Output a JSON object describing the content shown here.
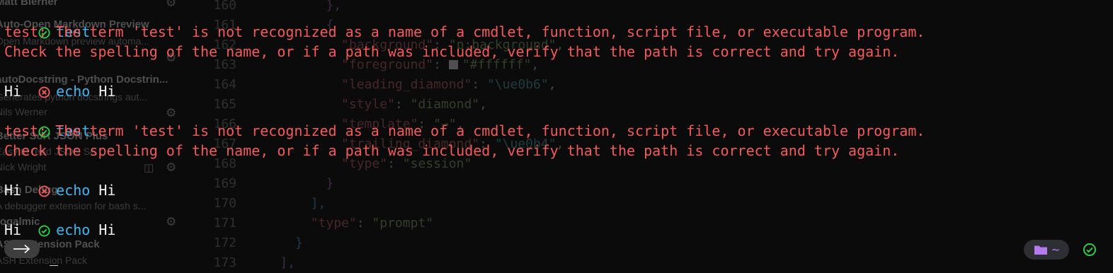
{
  "background_extensions": [
    {
      "title": "Matt Bierner",
      "desc": ""
    },
    {
      "title": "Auto-Open Markdown Preview",
      "desc": "Open Markdown preview automa..."
    },
    {
      "title": "autoDocstring - Python Docstrin...",
      "desc": "Generates python docstrings aut..."
    },
    {
      "title": "Nils Werner",
      "desc": ""
    },
    {
      "title": "Better Sort JSON Plus",
      "desc": "Easy to read JSON Se..."
    },
    {
      "title": "Nick Wright",
      "desc": ""
    },
    {
      "title": "Bash Debug",
      "desc": "A debugger extension for bash s..."
    },
    {
      "title": "rogalmic",
      "desc": ""
    },
    {
      "title": "ASH Extension Pack",
      "desc": "ASH Extension Pack"
    }
  ],
  "background_code": {
    "line_numbers": [
      "160",
      "161",
      "162",
      "163",
      "164",
      "165",
      "166",
      "167",
      "168",
      "169",
      "170",
      "171",
      "172",
      "173"
    ],
    "background_key": "\"background\"",
    "background_val": "\"p:background\"",
    "foreground_key": "\"foreground\"",
    "foreground_val": "\"#ffffff\"",
    "leading_key": "\"leading_diamond\"",
    "leading_val": "\"\\ue0b6\"",
    "style_key": "\"style\"",
    "style_val": "\"diamond\"",
    "template_key": "\"template\"",
    "template_val": "\"→\"",
    "trailing_key": "\"trailing_diamond\"",
    "trailing_val": "\"\\ue0b4\"",
    "type_key": "\"type\"",
    "type_val": "\"session\"",
    "type2_val": "\"prompt\""
  },
  "terminal": {
    "cmd_test": "test",
    "cmd_echo": "echo",
    "arg_hi": "Hi",
    "output_hi": "Hi",
    "error_line_1": "test: The term 'test' is not recognized as a name of a cmdlet, function, script file, or executable program.",
    "error_line_2": "Check the spelling of the name, or if a path was included, verify that the path is correct and try again.",
    "cursor": "_",
    "status_path": "~"
  },
  "colors": {
    "background": "#0b0b0b",
    "error": "#f45a5a",
    "command": "#3fb6f2",
    "success": "#2ecc40",
    "failure": "#f45a5a",
    "folder": "#b57bee"
  },
  "icons": {
    "success": "check-circle-icon",
    "failure": "x-circle-icon",
    "prompt": "arrow-right-icon",
    "folder": "folder-icon",
    "settings": "gear-icon"
  }
}
